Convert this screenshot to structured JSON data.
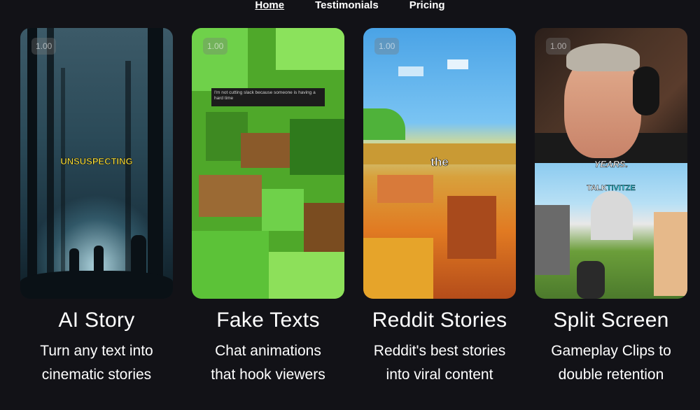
{
  "nav": {
    "items": [
      {
        "label": "Home",
        "active": true
      },
      {
        "label": "Testimonials",
        "active": false
      },
      {
        "label": "Pricing",
        "active": false
      }
    ]
  },
  "cards": [
    {
      "title": "AI Story",
      "desc_line1": "Turn any text into",
      "desc_line2": "cinematic stories",
      "speed": "1.00",
      "caption": "UNSUSPECTING"
    },
    {
      "title": "Fake Texts",
      "desc_line1": "Chat animations",
      "desc_line2": "that hook viewers",
      "speed": "1.00",
      "message": "I'm not cutting slack because someone is having a hard time"
    },
    {
      "title": "Reddit Stories",
      "desc_line1": "Reddit's best stories",
      "desc_line2": "into viral content",
      "speed": "1.00",
      "caption": "the"
    },
    {
      "title": "Split Screen",
      "desc_line1": "Gameplay Clips to",
      "desc_line2": "double retention",
      "speed": "1.00",
      "caption_top": "YEARS.",
      "caption_bottom_a": "TALK",
      "caption_bottom_b": "TIVITZE"
    }
  ],
  "colors": {
    "background": "#121217",
    "caption_yellow": "#ffe640",
    "caption_cyan": "#31d5e8"
  }
}
